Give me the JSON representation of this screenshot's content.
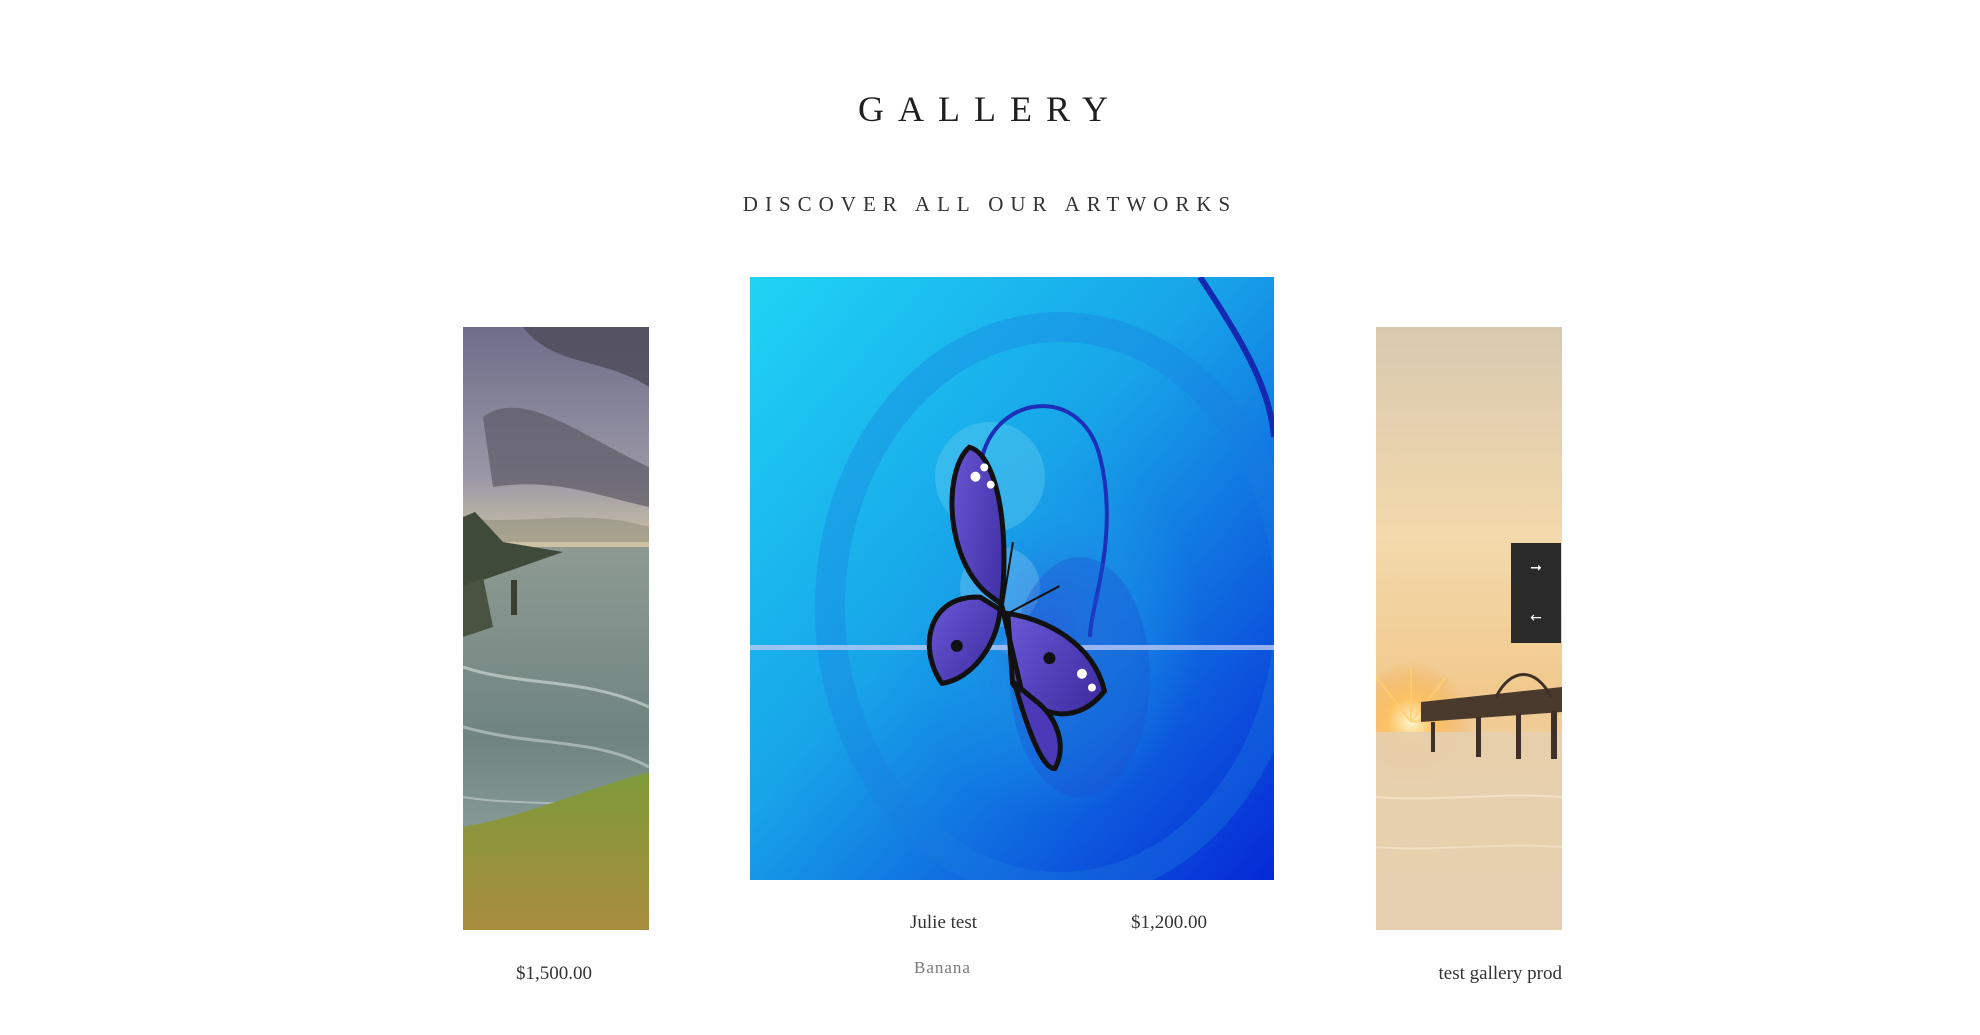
{
  "header": {
    "title": "GALLERY",
    "subtitle": "DISCOVER ALL OUR ARTWORKS"
  },
  "carousel": {
    "items": [
      {
        "image": "coastal-cliffs-seascape",
        "price": "$1,500.00"
      },
      {
        "image": "blue-butterfly-abstract",
        "name": "Julie test",
        "price": "$1,200.00",
        "artist": "Banana"
      },
      {
        "image": "sunset-bridge-water",
        "name": "test gallery prod"
      }
    ],
    "nav": {
      "next_icon": "arrow-right-icon",
      "prev_icon": "arrow-left-icon",
      "next_glyph": "➞",
      "prev_glyph": "←"
    }
  },
  "colors": {
    "nav_background": "#2a2a2a",
    "text": "#333333",
    "muted_text": "#7a7a7a"
  }
}
